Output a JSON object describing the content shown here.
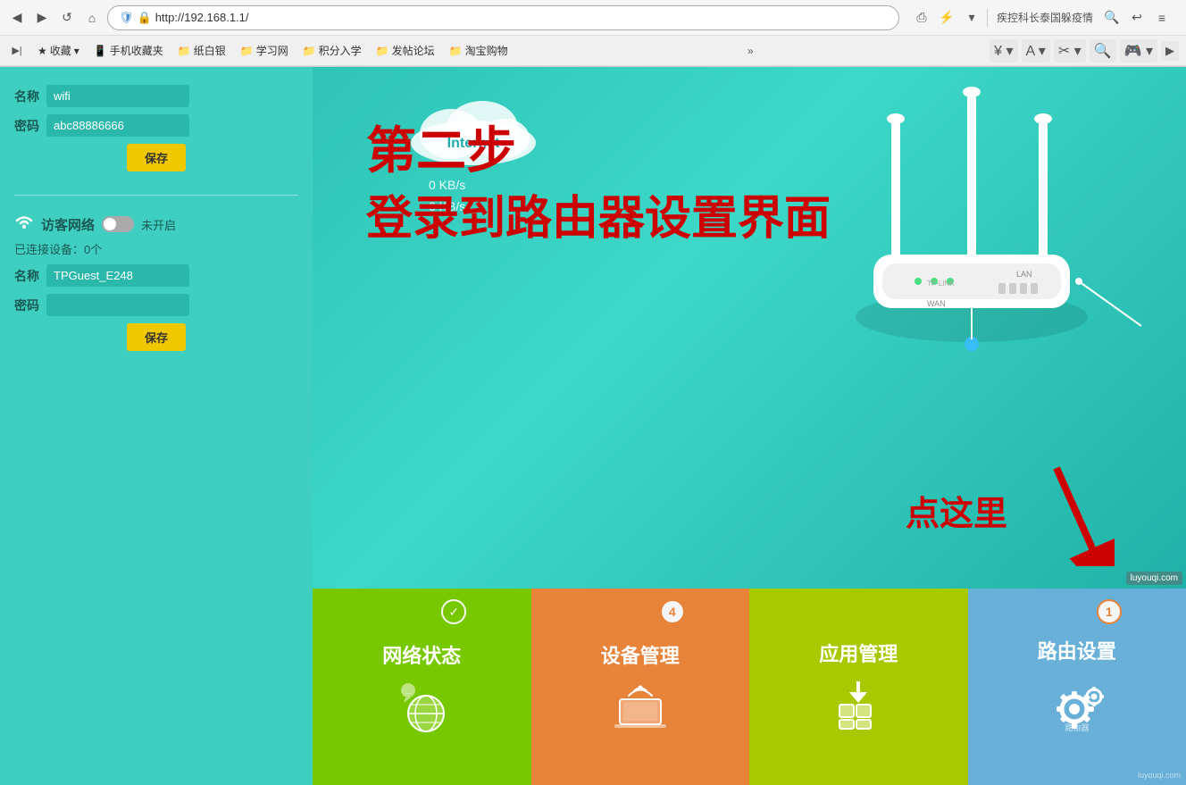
{
  "browser": {
    "address": "http://192.168.1.1/",
    "nav_back": "◀",
    "nav_forward": "▶",
    "nav_reload": "↺",
    "nav_home": "⌂",
    "search_right": "疾控科长泰国躲疫情",
    "undo": "↩",
    "menu": "≡"
  },
  "bookmarks": [
    {
      "label": "收藏",
      "icon": "★"
    },
    {
      "label": "手机收藏夹",
      "icon": "📱"
    },
    {
      "label": "纸白银",
      "icon": "📁"
    },
    {
      "label": "学习网",
      "icon": "📁"
    },
    {
      "label": "积分入学",
      "icon": "📁"
    },
    {
      "label": "发帖论坛",
      "icon": "📁"
    },
    {
      "label": "淘宝购物",
      "icon": "📁"
    }
  ],
  "sidebar": {
    "wifi_label": "名称",
    "wifi_value": "wifi",
    "password_label": "密码",
    "password_value": "abc88886666",
    "save_btn": "保存",
    "guest_title": "访客网络",
    "guest_status": "未开启",
    "connected_label": "已连接设备：0个",
    "guest_name_label": "名称",
    "guest_name_value": "TPGuest_E248",
    "guest_password_label": "密码",
    "guest_password_value": "",
    "guest_save_btn": "保存"
  },
  "overlay": {
    "step_title": "第二步",
    "step_subtitle": "登录到路由器设置界面",
    "click_here": "点这里"
  },
  "internet": {
    "label": "Internet",
    "speed1": "0 KB/s",
    "speed2": "0 KB/s"
  },
  "tiles": [
    {
      "id": "network-status",
      "label": "网络状态",
      "badge": "✓",
      "badge_type": "check",
      "color": "tile-green"
    },
    {
      "id": "device-management",
      "label": "设备管理",
      "badge": "4",
      "badge_type": "number",
      "color": "tile-orange"
    },
    {
      "id": "app-management",
      "label": "应用管理",
      "badge": "",
      "badge_type": "none",
      "color": "tile-yellow-green"
    },
    {
      "id": "router-settings",
      "label": "路由设置",
      "badge": "1",
      "badge_type": "number",
      "color": "tile-blue"
    }
  ],
  "watermark": "luyouqi.com",
  "icons": {
    "shield": "🛡",
    "wifi_symbol": "📶",
    "gear": "⚙",
    "globe": "🌐",
    "chat": "💬",
    "laptop_wifi": "💻",
    "download": "⬇",
    "grid": "⊞",
    "cog": "⚙"
  }
}
